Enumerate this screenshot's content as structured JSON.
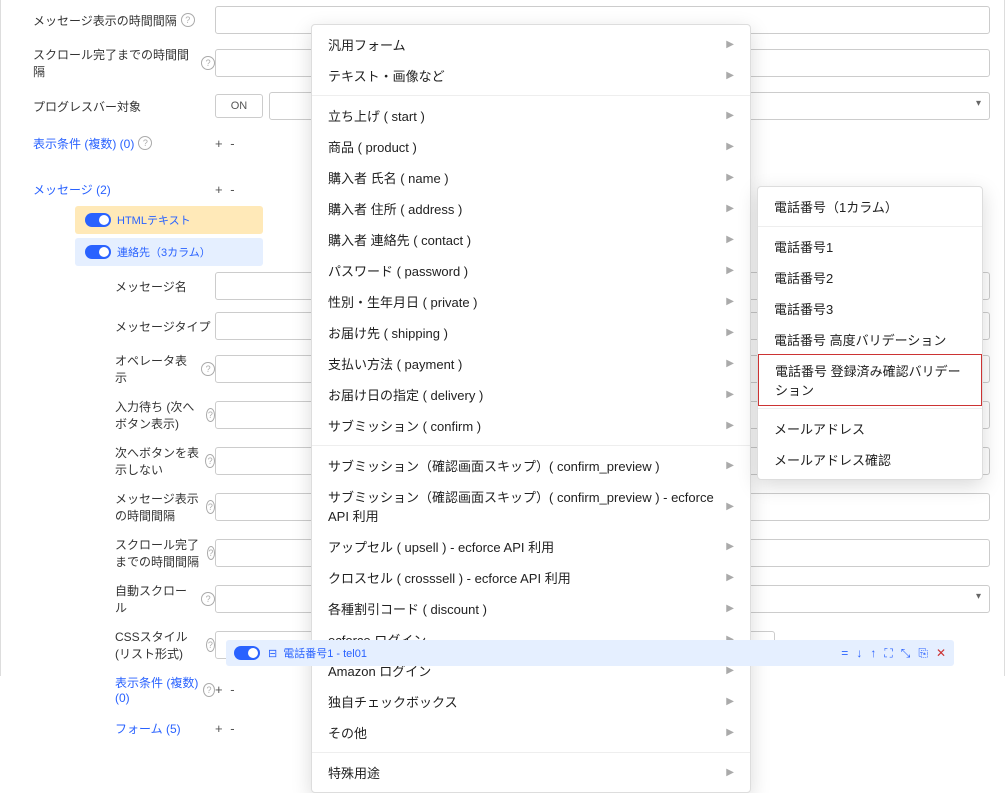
{
  "sidebar": {
    "rows": {
      "msg_interval": "メッセージ表示の時間間隔",
      "scroll_interval": "スクロール完了までの時間間隔",
      "progress": "プログレスバー対象",
      "conditions": "表示条件 (複数) (0)",
      "messages": "メッセージ (2)"
    },
    "on_label": "ON",
    "blocks": {
      "html_text": "HTMLテキスト",
      "contact3col": "連絡先（3カラム）"
    },
    "msg_fields": {
      "name": "メッセージ名",
      "type": "メッセージタイプ",
      "operator": "オペレータ表示",
      "input_wait": "入力待ち (次へボタン表示)",
      "no_next": "次へボタンを表示しない",
      "interval2": "メッセージ表示の時間間隔",
      "scroll2": "スクロール完了までの時間間隔",
      "autoscroll": "自動スクロール",
      "css": "CSSスタイル (リスト形式)",
      "cond2": "表示条件 (複数) (0)",
      "form": "フォーム (5)"
    }
  },
  "menu": {
    "items": [
      "汎用フォーム",
      "テキスト・画像など",
      "__divider",
      "立ち上げ ( start )",
      "商品 ( product )",
      "購入者 氏名 ( name )",
      "購入者 住所 ( address )",
      "購入者 連絡先 ( contact )",
      "パスワード ( password )",
      "性別・生年月日 ( private )",
      "お届け先 ( shipping )",
      "支払い方法 ( payment )",
      "お届け日の指定 ( delivery )",
      "サブミッション ( confirm )",
      "__divider",
      "サブミッション（確認画面スキップ）( confirm_preview )",
      "サブミッション（確認画面スキップ）( confirm_preview ) - ecforce API 利用",
      "アップセル ( upsell ) - ecforce API 利用",
      "クロスセル ( crosssell ) - ecforce API 利用",
      "各種割引コード ( discount )",
      "ecforce ログイン",
      "Amazon ログイン",
      "独自チェックボックス",
      "その他",
      "__divider",
      "特殊用途"
    ]
  },
  "submenu": {
    "title": "電話番号（1カラム）",
    "items": [
      "電話番号1",
      "電話番号2",
      "電話番号3",
      "電話番号 高度バリデーション",
      "電話番号 登録済み確認バリデーション",
      "__divider",
      "メールアドレス",
      "メールアドレス確認"
    ],
    "highlight_index": 4
  },
  "bottom": {
    "label": "電話番号1 - tel01",
    "icons": [
      "=",
      "↓",
      "↑",
      "⛶",
      "⤡",
      "⎘",
      "✕"
    ]
  },
  "action_icons": {
    "close": "×",
    "add": "+"
  }
}
